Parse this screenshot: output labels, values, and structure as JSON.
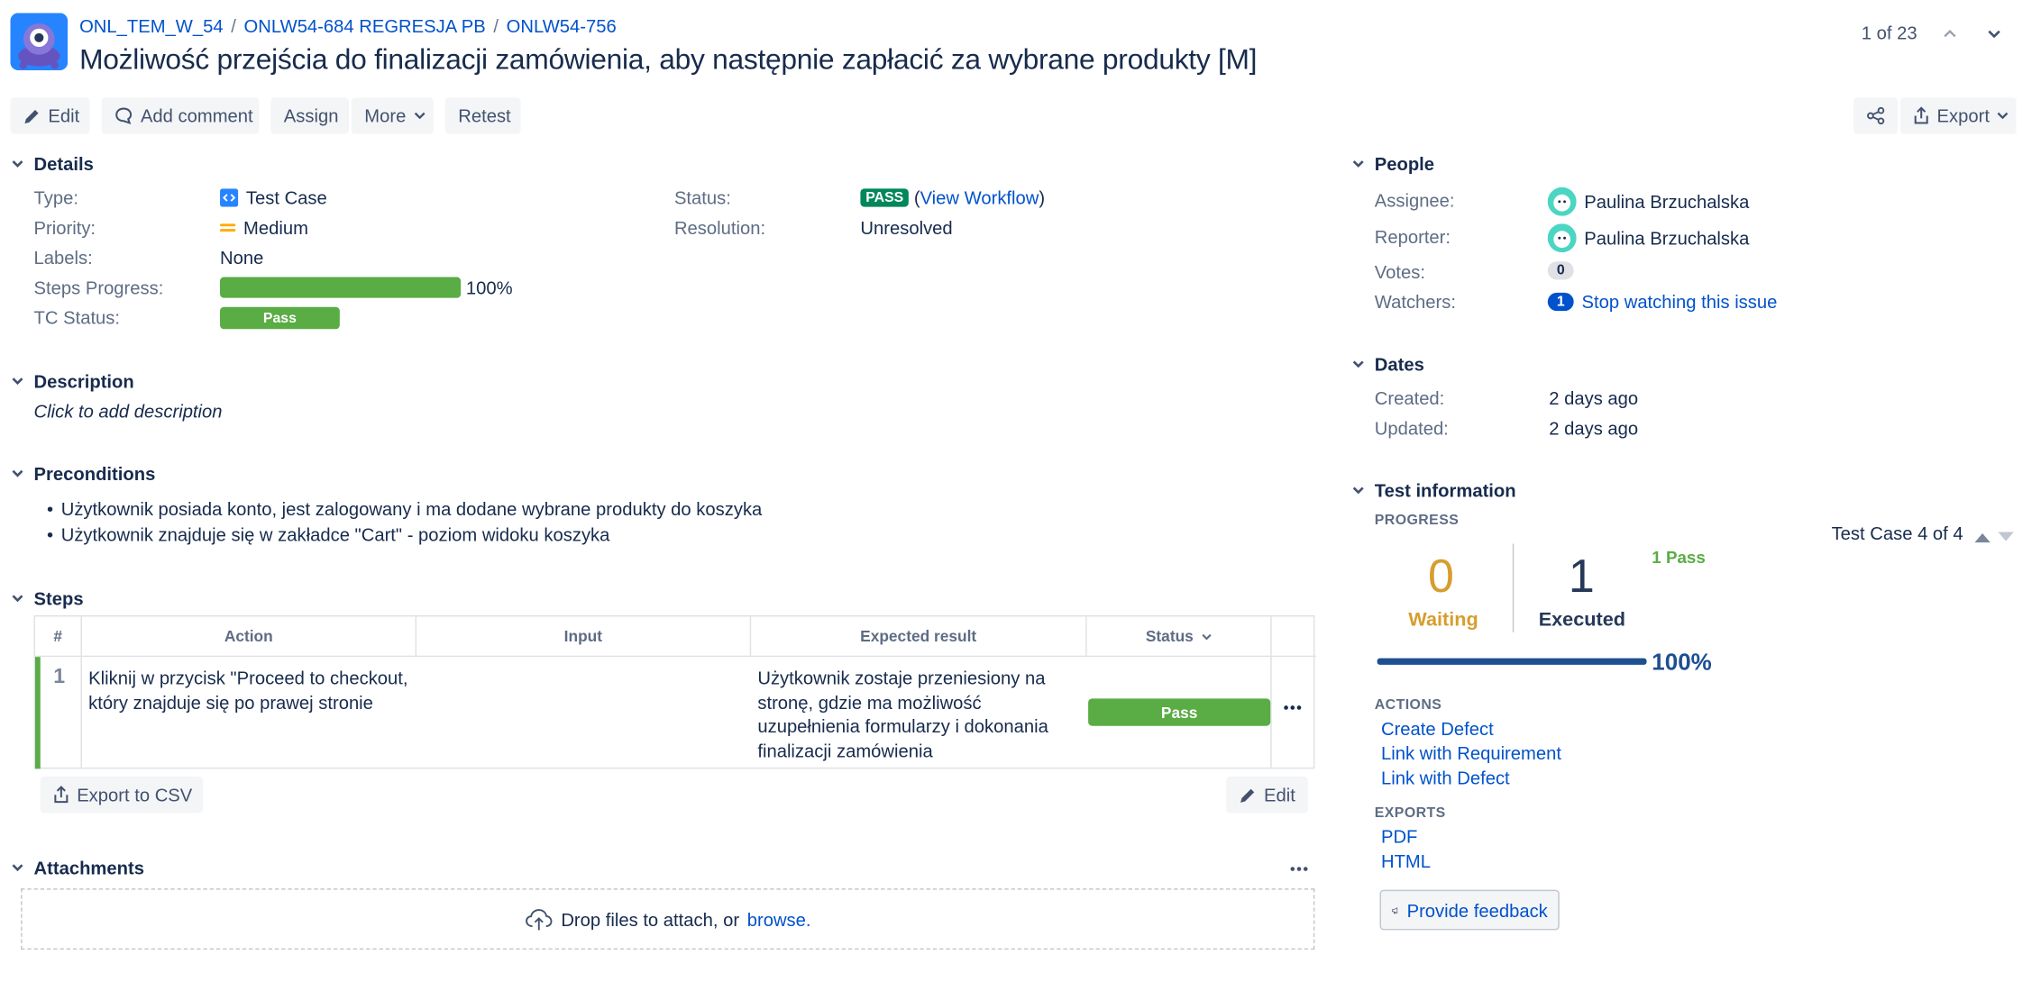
{
  "breadcrumb": {
    "project": "ONL_TEM_W_54",
    "parent": "ONLW54-684 REGRESJA PB",
    "issue": "ONLW54-756"
  },
  "title": "Możliwość przejścia do finalizacji zamówienia, aby następnie zapłacić za wybrane produkty [M]",
  "pager": {
    "text": "1 of 23"
  },
  "toolbar": {
    "edit": "Edit",
    "add_comment": "Add comment",
    "assign": "Assign",
    "more": "More",
    "retest": "Retest",
    "export": "Export"
  },
  "details": {
    "heading": "Details",
    "type_label": "Type:",
    "type_value": "Test Case",
    "priority_label": "Priority:",
    "priority_value": "Medium",
    "labels_label": "Labels:",
    "labels_value": "None",
    "steps_progress_label": "Steps Progress:",
    "steps_progress_value": "100%",
    "steps_progress_fraction": 1.0,
    "tc_status_label": "TC Status:",
    "tc_status_value": "Pass",
    "status_label": "Status:",
    "status_value": "PASS",
    "view_workflow": "View Workflow",
    "resolution_label": "Resolution:",
    "resolution_value": "Unresolved"
  },
  "description": {
    "heading": "Description",
    "placeholder": "Click to add description"
  },
  "preconditions": {
    "heading": "Preconditions",
    "items": [
      "Użytkownik posiada konto, jest zalogowany i ma dodane wybrane produkty do koszyka",
      "Użytkownik znajduje się w zakładce \"Cart\" - poziom widoku koszyka"
    ]
  },
  "steps": {
    "heading": "Steps",
    "columns": {
      "num": "#",
      "action": "Action",
      "input": "Input",
      "expected": "Expected result",
      "status": "Status"
    },
    "rows": [
      {
        "num": "1",
        "action": "Kliknij w przycisk \"Proceed to checkout, który znajduje się po prawej stronie",
        "input": "",
        "expected": "Użytkownik zostaje przeniesiony na stronę, gdzie ma możliwość uzupełnienia formularzy i dokonania finalizacji zamówienia",
        "status": "Pass"
      }
    ],
    "export_csv": "Export to CSV",
    "edit": "Edit"
  },
  "attachments": {
    "heading": "Attachments",
    "drop_text": "Drop files to attach, or",
    "browse": "browse."
  },
  "people": {
    "heading": "People",
    "assignee_label": "Assignee:",
    "assignee": "Paulina Brzuchalska",
    "reporter_label": "Reporter:",
    "reporter": "Paulina Brzuchalska",
    "votes_label": "Votes:",
    "votes": "0",
    "watchers_label": "Watchers:",
    "watchers": "1",
    "stop_watching": "Stop watching this issue"
  },
  "dates": {
    "heading": "Dates",
    "created_label": "Created:",
    "created": "2 days ago",
    "updated_label": "Updated:",
    "updated": "2 days ago"
  },
  "test_info": {
    "heading": "Test information",
    "progress_label": "PROGRESS",
    "nav": "Test Case 4 of 4",
    "waiting_count": "0",
    "waiting_label": "Waiting",
    "executed_count": "1",
    "executed_label": "Executed",
    "pass_summary": "1 Pass",
    "percent": "100%",
    "progress_fraction": 1.0,
    "actions_label": "ACTIONS",
    "actions": [
      "Create Defect",
      "Link with Requirement",
      "Link with Defect"
    ],
    "exports_label": "EXPORTS",
    "exports": [
      "PDF",
      "HTML"
    ],
    "feedback": "Provide feedback"
  },
  "colors": {
    "link": "#0052cc",
    "pass_green": "#5aac44",
    "status_green": "#00875a",
    "waiting": "#d69e2e",
    "executed": "#253858",
    "progress_bar": "#1d4f91"
  }
}
